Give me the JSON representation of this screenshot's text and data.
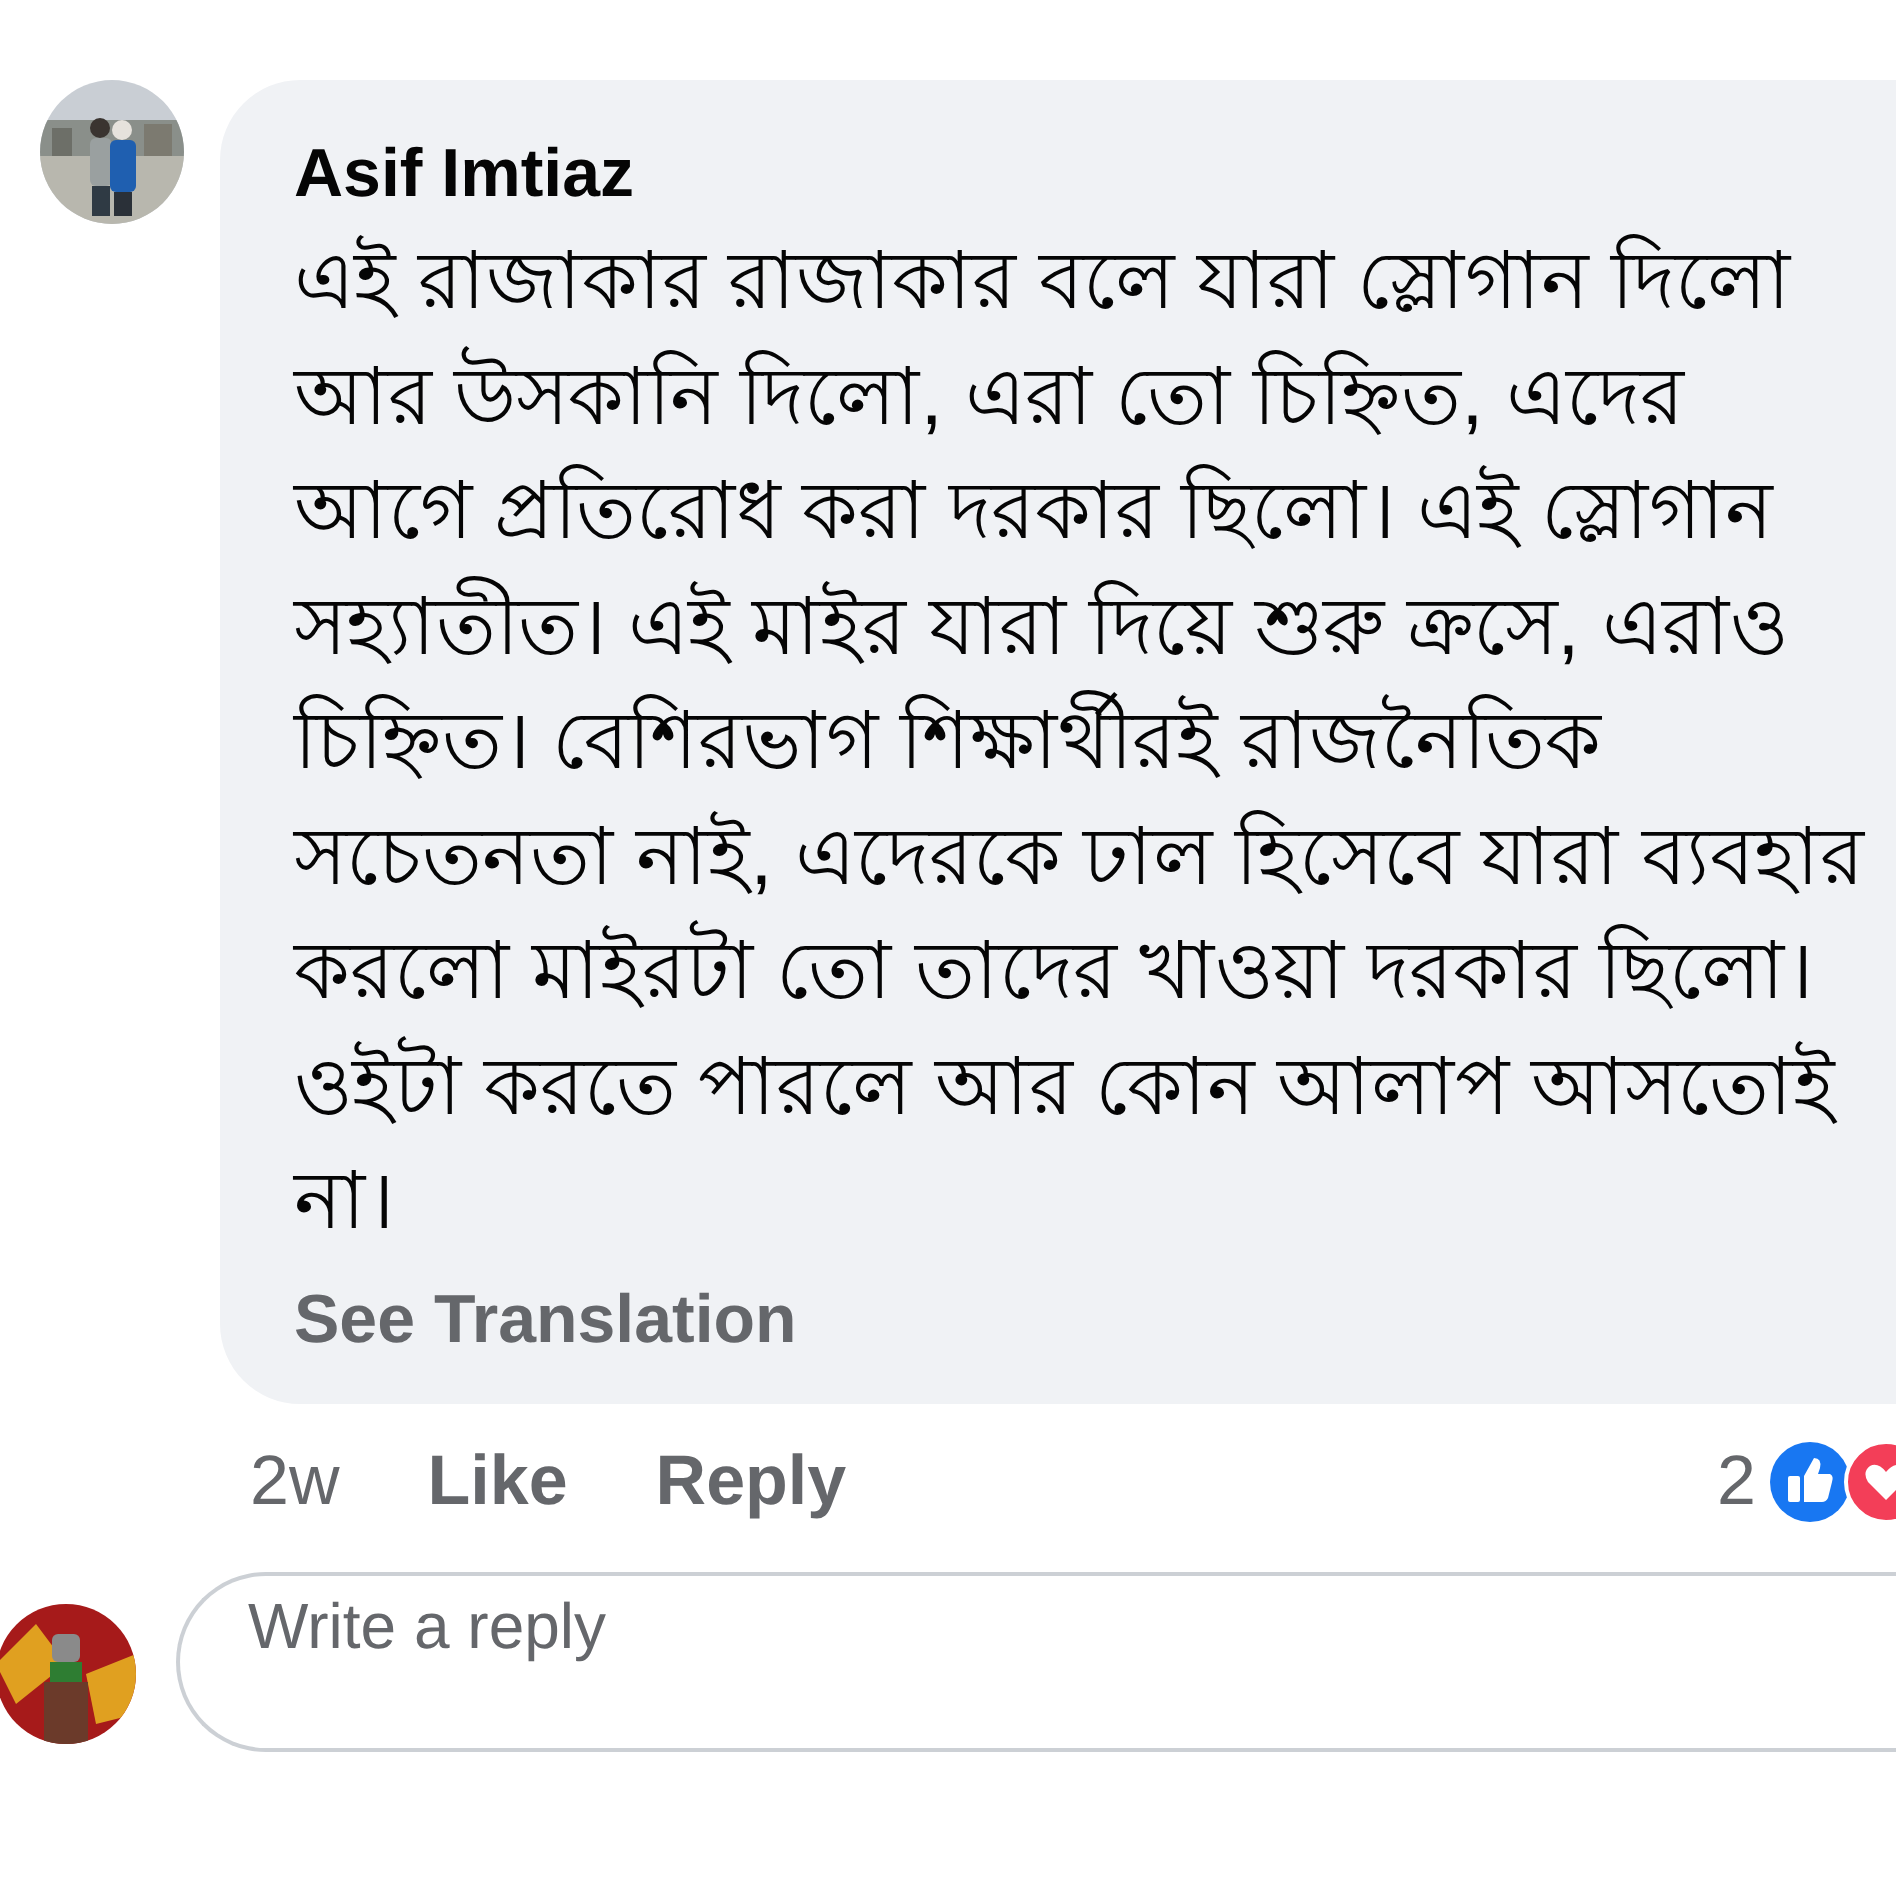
{
  "comment": {
    "author": "Asif Imtiaz",
    "text": "এই রাজাকার রাজাকার বলে যারা স্লোগান দিলো আর উসকানি দিলো, এরা তো চিহ্নিত, এদের আগে প্রতিরোধ করা দরকার ছিলো। এই স্লোগান সহ্যাতীত। এই মাইর যারা দিয়ে শুরু ক্রসে, এরাও চিহ্নিত। বেশিরভাগ শিক্ষার্থীরই রাজনৈতিক সচেতনতা নাই, এদেরকে ঢাল হিসেবে যারা ব্যবহার করলো মাইরটা তো তাদের খাওয়া দরকার ছিলো। ওইটা করতে পারলে আর কোন আলাপ আসতোই না।",
    "see_translation": "See Translation",
    "time": "2w",
    "actions": [
      "Like",
      "Reply"
    ],
    "reaction_count": "2"
  },
  "reply_box": {
    "placeholder": "Write a reply"
  }
}
